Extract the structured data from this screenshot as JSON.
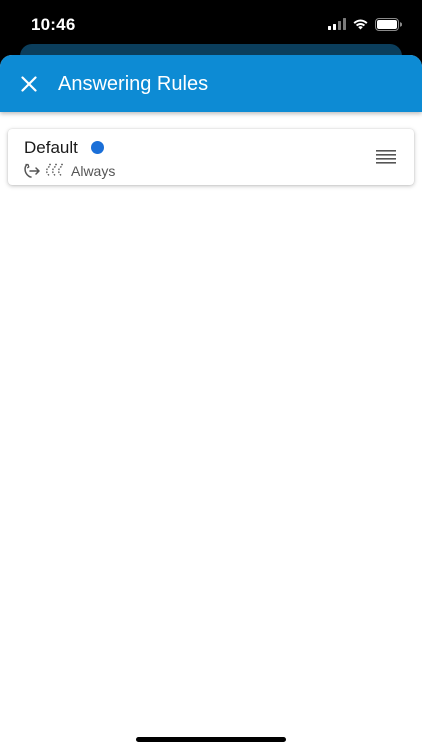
{
  "status_bar": {
    "time": "10:46",
    "icons": [
      "cellular-signal-icon",
      "wifi-icon",
      "battery-icon"
    ]
  },
  "header": {
    "title": "Answering Rules",
    "close_icon": "close-icon",
    "background_color": "#0d8bd4"
  },
  "rules": [
    {
      "name": "Default",
      "status_color": "#1a6fd8",
      "icons": [
        "call-forward-icon",
        "ring-sequence-icon"
      ],
      "schedule": "Always",
      "handle_icon": "drag-handle-icon"
    }
  ]
}
